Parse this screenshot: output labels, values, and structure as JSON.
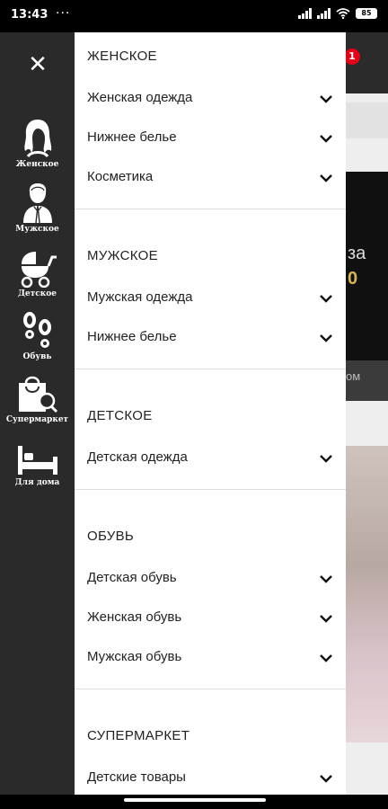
{
  "status": {
    "time": "13:43",
    "dots": "···",
    "battery": "85"
  },
  "background": {
    "badge": "1",
    "banner_text1": "за",
    "banner_text2": "0",
    "strip_text": "ом"
  },
  "rail": {
    "close": "✕",
    "items": [
      {
        "label": "Женское",
        "icon": "woman-icon"
      },
      {
        "label": "Мужское",
        "icon": "man-icon"
      },
      {
        "label": "Детское",
        "icon": "stroller-icon"
      },
      {
        "label": "Обувь",
        "icon": "footprints-icon"
      },
      {
        "label": "Супермаркет",
        "icon": "shopping-bag-search-icon"
      },
      {
        "label": "Для дома",
        "icon": "bed-icon"
      }
    ]
  },
  "sections": [
    {
      "title": "ЖЕНСКОЕ",
      "items": [
        "Женская одежда",
        "Нижнее белье",
        "Косметика"
      ]
    },
    {
      "title": "МУЖСКОЕ",
      "items": [
        "Мужская одежда",
        "Нижнее белье"
      ]
    },
    {
      "title": "ДЕТСКОЕ",
      "items": [
        "Детская одежда"
      ]
    },
    {
      "title": "ОБУВЬ",
      "items": [
        "Детская обувь",
        "Женская обувь",
        "Мужская обувь"
      ]
    },
    {
      "title": "СУПЕРМАРКЕТ",
      "items": [
        "Детские товары"
      ]
    }
  ]
}
